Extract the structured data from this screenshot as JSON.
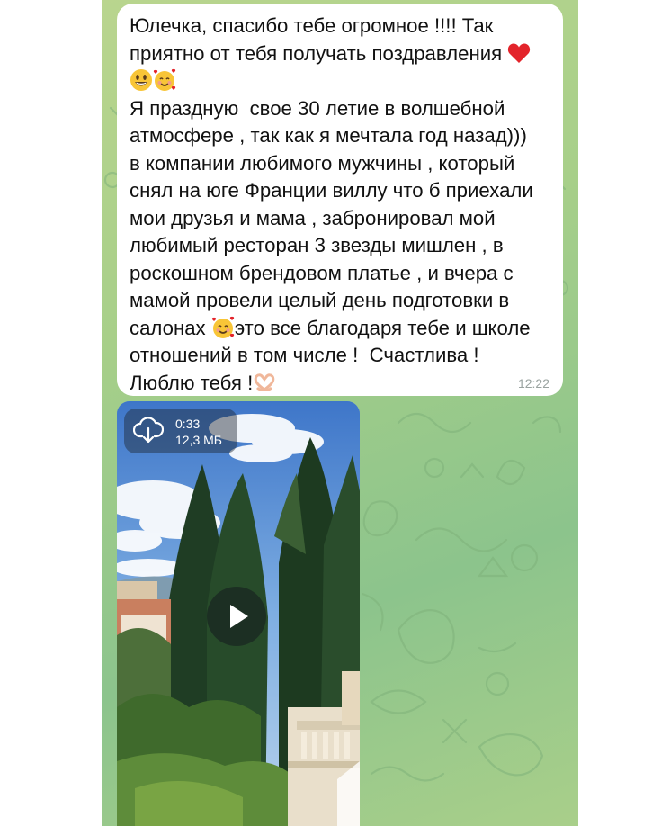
{
  "message": {
    "lines": [
      "Юлечка, спасибо тебе огромное !!!! Так",
      "приятно от тебя получать поздравления",
      "Я праздную  свое 30 летие в волшебной",
      "атмосфере , так как я мечтала год назад)))",
      "в компании любимого мужчины , который",
      "снял на юге Франции виллу что б приехали",
      "мои друзья и мама , забронировал мой",
      "любимый ресторан 3 звезды мишлен , в",
      "роскошном брендовом платье , и вчера с",
      "мамой провели целый день подготовки в",
      "салонах",
      "это все благодаря тебе и школе",
      "отношений в том числе !  Счастлива !",
      "Люблю тебя !"
    ],
    "emojis": [
      "red-heart",
      "grinning-face",
      "smiling-face-with-hearts",
      "heart-hands"
    ],
    "time": "12:22"
  },
  "video": {
    "duration": "0:33",
    "size": "12,3 МБ",
    "icon": "cloud-download-icon"
  },
  "colors": {
    "wallpaper": "#a7cf89",
    "bubble": "#ffffff",
    "timestamp": "#9aa3a0"
  }
}
